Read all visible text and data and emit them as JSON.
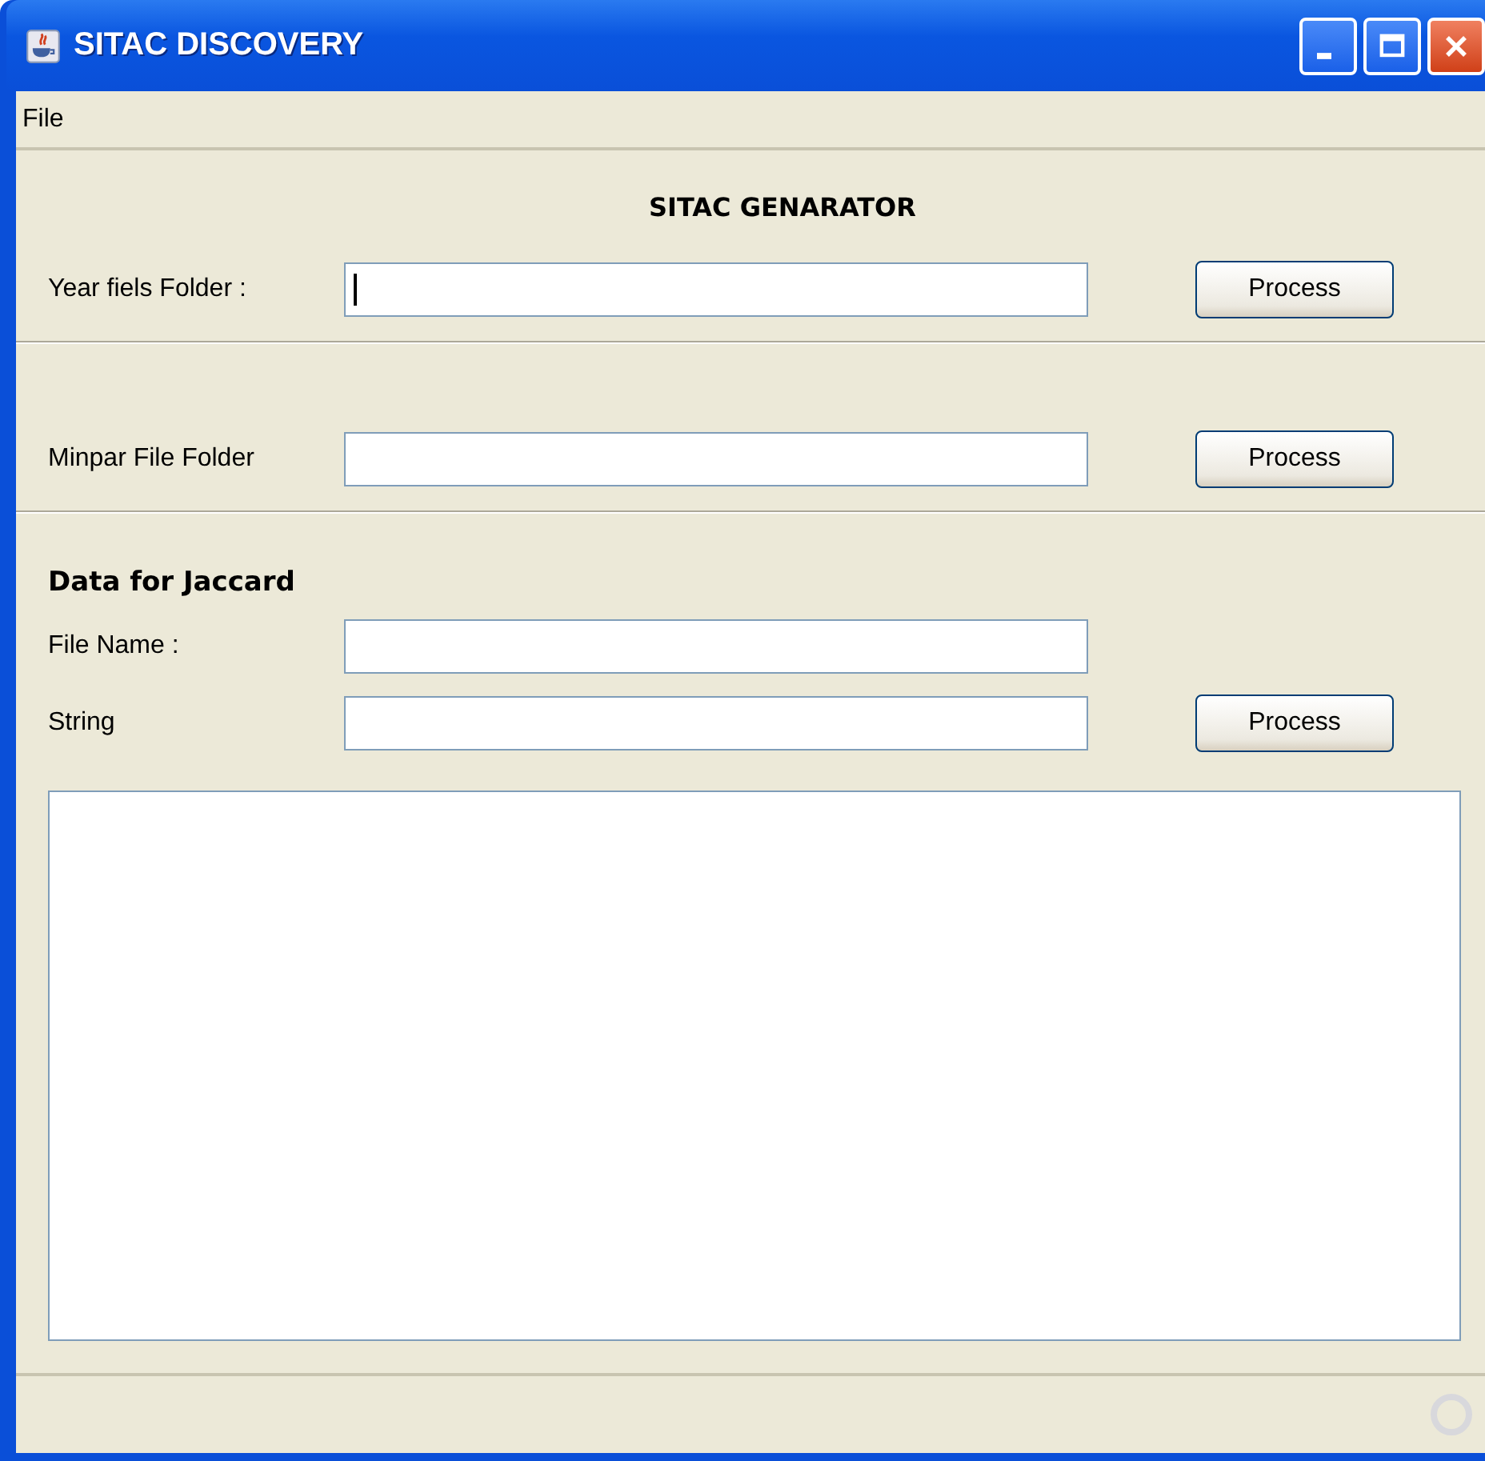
{
  "window": {
    "title": "SITAC DISCOVERY"
  },
  "menu": [
    {
      "label": "File"
    }
  ],
  "heading": "SITAC GENARATOR",
  "sections": [
    {
      "kind": "row",
      "label": "Year fiels Folder :",
      "focused": true,
      "button": "Process"
    },
    {
      "kind": "divider"
    },
    {
      "kind": "row",
      "label": "Minpar File Folder",
      "focused": false,
      "button": "Process"
    },
    {
      "kind": "divider"
    },
    {
      "kind": "title",
      "label": "Data for Jaccard"
    },
    {
      "kind": "row",
      "label": "File Name :",
      "focused": false
    },
    {
      "kind": "row",
      "label": "String",
      "focused": false,
      "button": "Process"
    }
  ]
}
